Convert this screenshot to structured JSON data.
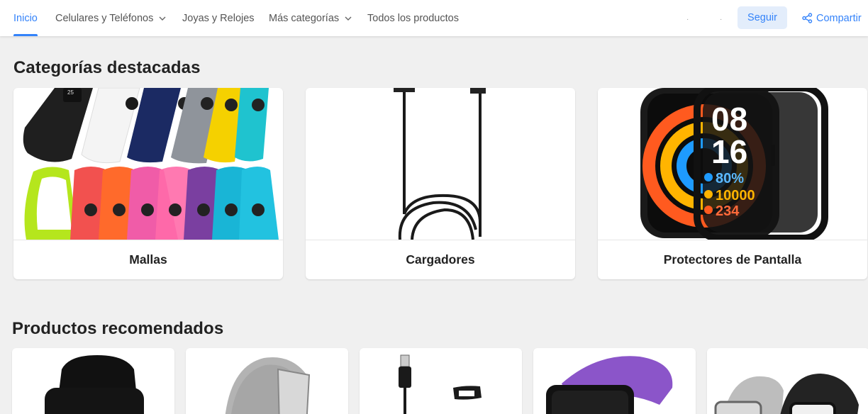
{
  "nav": {
    "items": [
      {
        "label": "Inicio",
        "active": true,
        "dropdown": false
      },
      {
        "label": "Celulares y Teléfonos",
        "active": false,
        "dropdown": true
      },
      {
        "label": "Joyas y Relojes",
        "active": false,
        "dropdown": false
      },
      {
        "label": "Más categorías",
        "active": false,
        "dropdown": true
      },
      {
        "label": "Todos los productos",
        "active": false,
        "dropdown": false
      }
    ],
    "follow_label": "Seguir",
    "share_label": "Compartir"
  },
  "featured": {
    "title": "Categorías destacadas",
    "cards": [
      {
        "label": "Mallas"
      },
      {
        "label": "Cargadores"
      },
      {
        "label": "Protectores de Pantalla",
        "screen_lines": [
          "08",
          "16",
          "80%",
          "10000",
          "234"
        ]
      }
    ]
  },
  "recommended": {
    "title": "Productos recomendados",
    "cards": [
      {
        "icon": "black-band-watch-icon"
      },
      {
        "icon": "milanese-silver-strap-icon"
      },
      {
        "icon": "usb-charger-cable-icon"
      },
      {
        "icon": "purple-band-watch-icon"
      },
      {
        "icon": "milanese-strap-pair-icon"
      }
    ]
  },
  "colors": {
    "accent": "#3483fa",
    "follow_bg": "#e3edfb",
    "page_bg": "#f0f0f0",
    "band_colors": [
      "#1c1c1c",
      "#f2f2f2",
      "#1b2a63",
      "#8f949b",
      "#f5d100",
      "#1fc3cf",
      "#b5e61d",
      "#f2514f",
      "#ff6a2b",
      "#f05ca8",
      "#7a3fa0",
      "#19b5d6"
    ]
  }
}
